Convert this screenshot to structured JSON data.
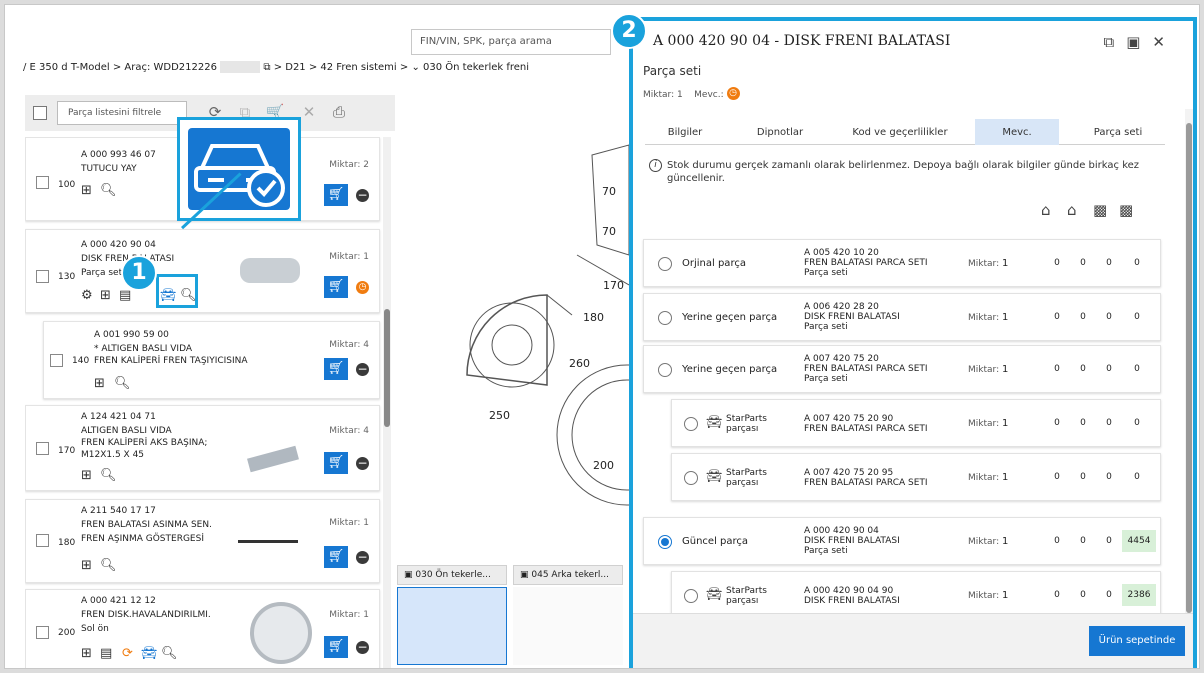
{
  "search": {
    "placeholder": "FIN/VIN, SPK, parça arama"
  },
  "breadcrumb": {
    "part1": "/ E 350 d T-Model > Araç: WDD212226",
    "part2": "> D21 > 42 Fren sistemi >",
    "part3": "030 Ön tekerlek freni"
  },
  "toolbar": {
    "filter_placeholder": "Parça listesini filtrele"
  },
  "qty_label": "Miktar:",
  "parts": [
    {
      "pos": "100",
      "pn": "A 000 993 46 07",
      "d1": "TUTUCU YAY",
      "d2": "",
      "d3": "",
      "qty": "2"
    },
    {
      "pos": "130",
      "pn": "A 000 420 90 04",
      "d1": "DISK FREN BALATASI",
      "d2": "Parça seti",
      "d3": "",
      "qty": "1"
    },
    {
      "pos": "140",
      "pn": "A 001 990 59 00",
      "d1": "* ALTIGEN BASLI VIDA",
      "d2": "FREN KALİPERİ FREN TAŞIYICISINA",
      "d3": "",
      "qty": "4"
    },
    {
      "pos": "170",
      "pn": "A 124 421 04 71",
      "d1": "ALTIGEN BASLI VIDA",
      "d2": "FREN KALİPERİ AKS BAŞINA;",
      "d3": "M12X1.5 X 45",
      "qty": "4"
    },
    {
      "pos": "180",
      "pn": "A 211 540 17 17",
      "d1": "FREN BALATASI ASINMA SEN.",
      "d2": "FREN AŞINMA GÖSTERGESİ",
      "d3": "",
      "qty": "1"
    },
    {
      "pos": "200",
      "pn": "A 000 421 12 12",
      "d1": "FREN DISK.HAVALANDIRILMI.",
      "d2": "Sol ön",
      "d3": "",
      "qty": "1"
    }
  ],
  "diagram": {
    "labels": [
      "170",
      "180",
      "250",
      "260",
      "200",
      "70",
      "70"
    ]
  },
  "thumbs": [
    {
      "label": "030 Ön tekerle..."
    },
    {
      "label": "045 Arka tekerl..."
    }
  ],
  "callouts": {
    "one": "1",
    "two": "2"
  },
  "panel": {
    "title": "A 000 420 90 04 - DISK FRENI BALATASI",
    "subtitle": "Parça seti",
    "qty_text": "Miktar: 1",
    "avail_text": "Mevc.:",
    "tabs": [
      "Bilgiler",
      "Dipnotlar",
      "Kod ve geçerlilikler",
      "Mevc.",
      "Parça seti"
    ],
    "info": "Stok durumu gerçek zamanlı olarak belirlenmez. Depoya bağlı olarak bilgiler günde birkaç kez güncellenir.",
    "rows": [
      {
        "label": "Orjinal parça",
        "pn": "A 005 420 10 20",
        "desc": "FREN BALATASI PARCA SETI",
        "set": "Parça seti",
        "qty": "1",
        "v": [
          "0",
          "0",
          "0",
          "0"
        ]
      },
      {
        "label": "Yerine geçen parça",
        "pn": "A 006 420 28 20",
        "desc": "DISK FRENI BALATASI",
        "set": "Parça seti",
        "qty": "1",
        "v": [
          "0",
          "0",
          "0",
          "0"
        ]
      },
      {
        "label": "Yerine geçen parça",
        "pn": "A 007 420 75 20",
        "desc": "FREN BALATASI PARCA SETI",
        "set": "Parça seti",
        "qty": "1",
        "v": [
          "0",
          "0",
          "0",
          "0"
        ]
      },
      {
        "sp1": "StarParts",
        "sp2": "parçası",
        "pn": "A 007 420 75 20 90",
        "desc": "FREN BALATASI PARCA SETI",
        "qty": "1",
        "v": [
          "0",
          "0",
          "0",
          "0"
        ]
      },
      {
        "sp1": "StarParts",
        "sp2": "parçası",
        "pn": "A 007 420 75 20 95",
        "desc": "FREN BALATASI PARCA SETI",
        "qty": "1",
        "v": [
          "0",
          "0",
          "0",
          "0"
        ]
      },
      {
        "label": "Güncel parça",
        "pn": "A 000 420 90 04",
        "desc": "DISK FRENI BALATASI",
        "set": "Parça seti",
        "qty": "1",
        "v": [
          "0",
          "0",
          "0",
          "4454"
        ]
      },
      {
        "sp1": "StarParts",
        "sp2": "parçası",
        "pn": "A 000 420 90 04 90",
        "desc": "DISK FRENI BALATASI",
        "qty": "1",
        "v": [
          "0",
          "0",
          "0",
          "2386"
        ]
      }
    ],
    "basket": "Ürün sepetinde"
  },
  "colors": {
    "accent": "#1677d2",
    "callout": "#1aa2dc",
    "clock": "#f07c10",
    "stock_green": "#d8f0d8"
  }
}
